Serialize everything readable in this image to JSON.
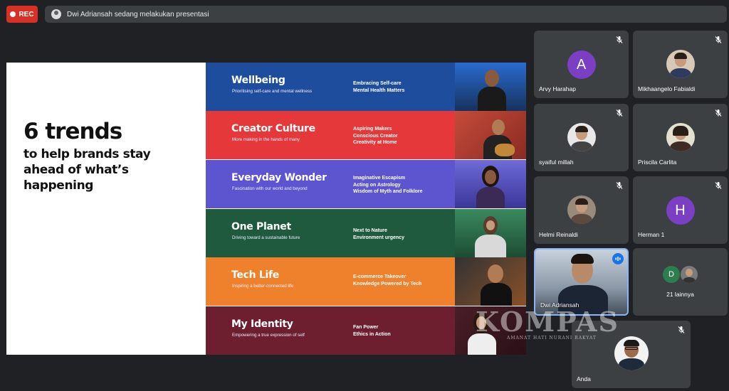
{
  "recording": {
    "label": "REC"
  },
  "presentation_bar": {
    "text": "Dwi Adriansah sedang melakukan presentasi"
  },
  "slide": {
    "title": "6 trends",
    "subtitle": "to help brands stay ahead of what’s happening",
    "trends": [
      {
        "name": "Wellbeing",
        "tagline": "Prioritising self-care and mental wellness",
        "points": [
          "Embracing Self-care",
          "Mental Health Matters"
        ],
        "color": "#1f4d9e"
      },
      {
        "name": "Creator Culture",
        "tagline": "More making in the hands of many",
        "points": [
          "Aspiring Makers",
          "Conscious Creator",
          "Creativity at Home"
        ],
        "color": "#e4383a"
      },
      {
        "name": "Everyday Wonder",
        "tagline": "Fascination with our world and beyond",
        "points": [
          "Imaginative Escapism",
          "Acting on Astrology",
          "Wisdom of Myth and Folklore"
        ],
        "color": "#5c55cf"
      },
      {
        "name": "One Planet",
        "tagline": "Driving toward a sustainable future",
        "points": [
          "Next to Nature",
          "Environment urgency"
        ],
        "color": "#1f5a3e"
      },
      {
        "name": "Tech Life",
        "tagline": "Inspiring a better-connected life",
        "points": [
          "E-commerce Takeover",
          "Knowledge Powered by Tech"
        ],
        "color": "#f0812c"
      },
      {
        "name": "My Identity",
        "tagline": "Empowering a true expression of self",
        "points": [
          "Fan Power",
          "Ethics in Action"
        ],
        "color": "#6d1f30"
      }
    ]
  },
  "participants": [
    {
      "name": "Arvy Harahap",
      "initial": "A",
      "avatar_color": "#7b3fc4",
      "muted": true
    },
    {
      "name": "Mikhaangelo Fabialdi",
      "muted": true
    },
    {
      "name": "syaiful millah",
      "muted": true
    },
    {
      "name": "Priscila Carlita",
      "muted": true
    },
    {
      "name": "Helmi Reinaldi",
      "muted": true
    },
    {
      "name": "Herman 1",
      "initial": "H",
      "avatar_color": "#7b3fc4",
      "muted": true
    },
    {
      "name": "Dwi Adriansah",
      "speaking": true
    },
    {
      "name": "21 lainnya",
      "initial": "D",
      "avatar_color": "#2e7d4f"
    },
    {
      "name": "Anda",
      "muted": true
    }
  ],
  "watermark": {
    "text": "KOMPAS",
    "sub": "AMANAT HATI NURANI RAKYAT"
  },
  "colors": {
    "background": "#202124",
    "tile": "#3c4043",
    "active_border": "#8ab4f8",
    "rec": "#d93025"
  }
}
